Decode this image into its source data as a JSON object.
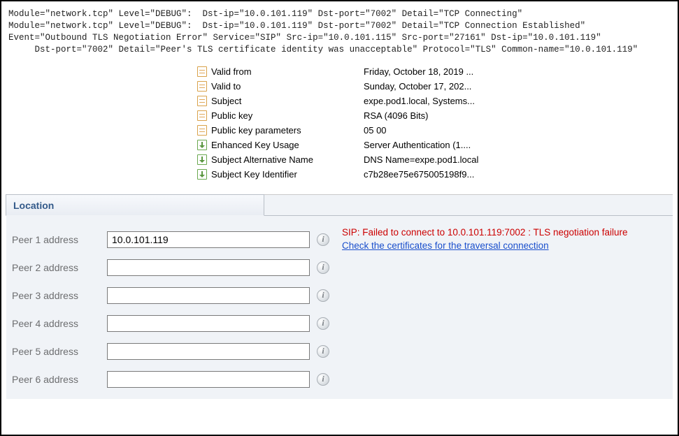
{
  "log": {
    "line1": "Module=\"network.tcp\" Level=\"DEBUG\":  Dst-ip=\"10.0.101.119\" Dst-port=\"7002\" Detail=\"TCP Connecting\"",
    "line2": "Module=\"network.tcp\" Level=\"DEBUG\":  Dst-ip=\"10.0.101.119\" Dst-port=\"7002\" Detail=\"TCP Connection Established\"",
    "line3": "Event=\"Outbound TLS Negotiation Error\" Service=\"SIP\" Src-ip=\"10.0.101.115\" Src-port=\"27161\" Dst-ip=\"10.0.101.119\"",
    "line4": "     Dst-port=\"7002\" Detail=\"Peer's TLS certificate identity was unacceptable\" Protocol=\"TLS\" Common-name=\"10.0.101.119\""
  },
  "cert": {
    "fields": [
      {
        "icon": "doc",
        "label": "Valid from",
        "value": "Friday, October 18, 2019 ..."
      },
      {
        "icon": "doc",
        "label": "Valid to",
        "value": "Sunday, October 17, 202..."
      },
      {
        "icon": "doc",
        "label": "Subject",
        "value": "expe.pod1.local, Systems..."
      },
      {
        "icon": "doc",
        "label": "Public key",
        "value": "RSA (4096 Bits)"
      },
      {
        "icon": "doc",
        "label": "Public key parameters",
        "value": "05 00"
      },
      {
        "icon": "ext",
        "label": "Enhanced Key Usage",
        "value": "Server Authentication (1...."
      },
      {
        "icon": "ext",
        "label": "Subject Alternative Name",
        "value": "DNS Name=expe.pod1.local"
      },
      {
        "icon": "ext",
        "label": "Subject Key Identifier",
        "value": "c7b28ee75e675005198f9..."
      }
    ]
  },
  "location": {
    "title": "Location",
    "error": "SIP: Failed to connect to 10.0.101.119:7002 : TLS negotiation failure",
    "help_link": "Check the certificates for the traversal connection",
    "peers": [
      {
        "label": "Peer 1 address",
        "value": "10.0.101.119"
      },
      {
        "label": "Peer 2 address",
        "value": ""
      },
      {
        "label": "Peer 3 address",
        "value": ""
      },
      {
        "label": "Peer 4 address",
        "value": ""
      },
      {
        "label": "Peer 5 address",
        "value": ""
      },
      {
        "label": "Peer 6 address",
        "value": ""
      }
    ]
  }
}
